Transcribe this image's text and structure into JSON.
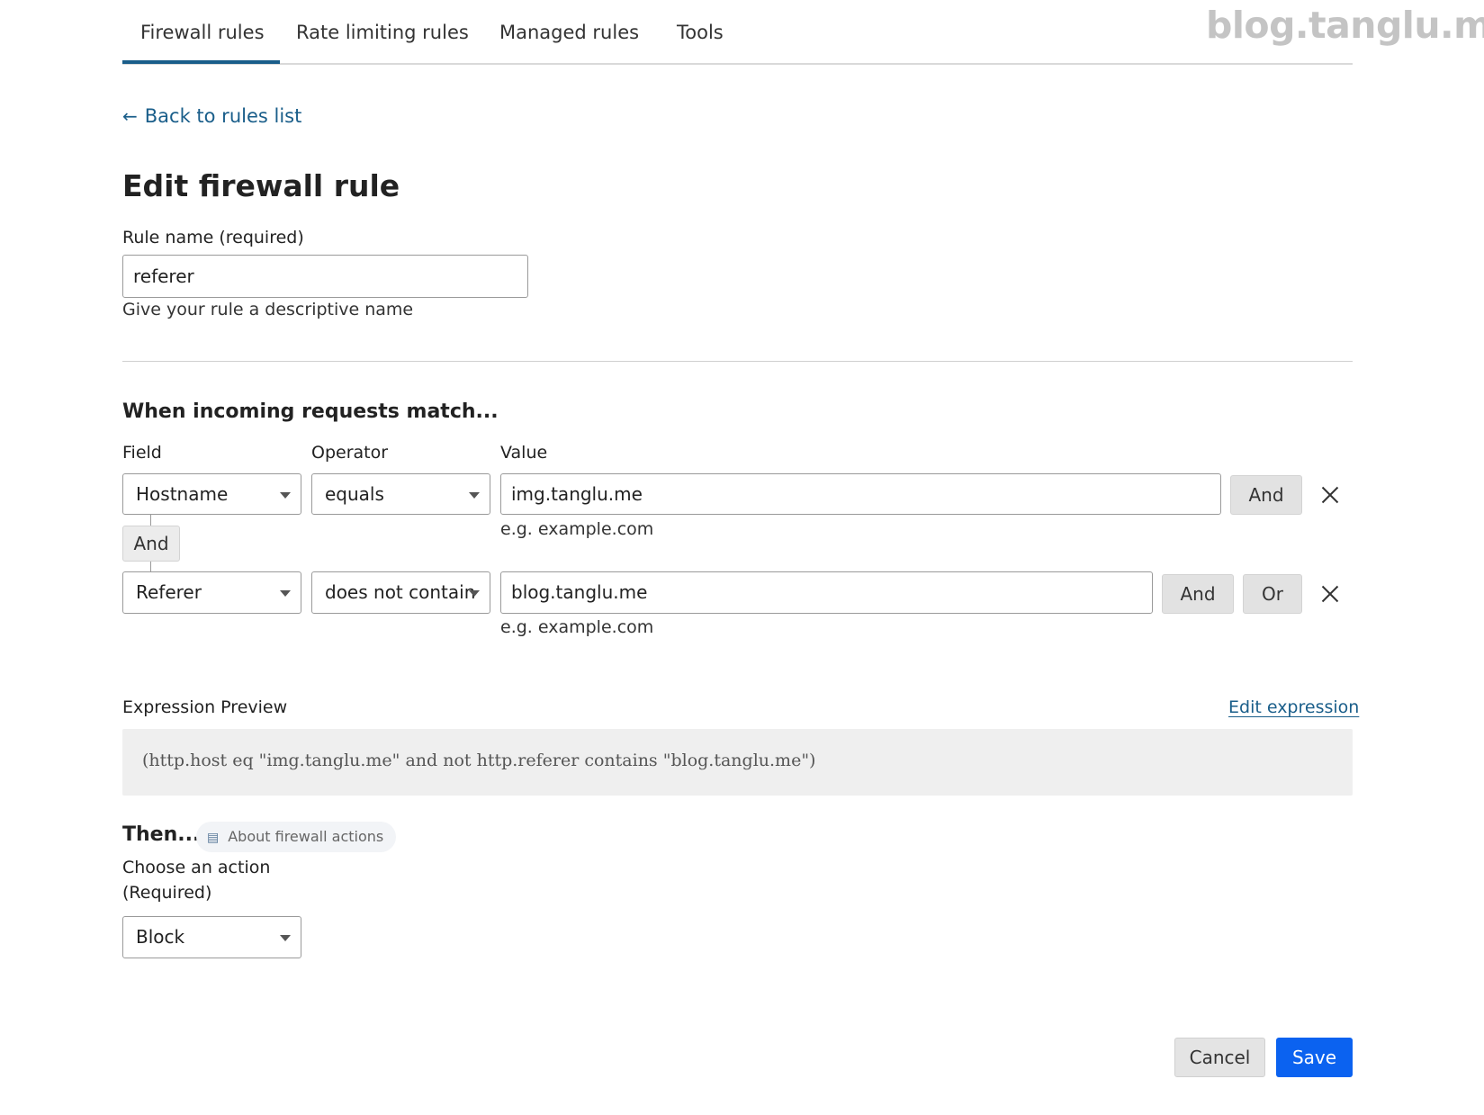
{
  "watermark": "blog.tanglu.me",
  "tabs": [
    {
      "label": "Firewall rules",
      "active": true
    },
    {
      "label": "Rate limiting rules",
      "active": false
    },
    {
      "label": "Managed rules",
      "active": false
    },
    {
      "label": "Tools",
      "active": false
    }
  ],
  "back_link": "Back to rules list",
  "page_title": "Edit firewall rule",
  "rule_name": {
    "label": "Rule name (required)",
    "value": "referer",
    "hint": "Give your rule a descriptive name"
  },
  "match_section": {
    "title": "When incoming requests match...",
    "headers": {
      "field": "Field",
      "operator": "Operator",
      "value": "Value"
    },
    "conditions": [
      {
        "field": "Hostname",
        "operator": "equals",
        "value": "img.tanglu.me",
        "hint": "e.g. example.com",
        "buttons": [
          "And"
        ]
      },
      {
        "field": "Referer",
        "operator": "does not contain",
        "value": "blog.tanglu.me",
        "hint": "e.g. example.com",
        "buttons": [
          "And",
          "Or"
        ]
      }
    ],
    "connector_label": "And"
  },
  "expression": {
    "label": "Expression Preview",
    "edit_link": "Edit expression",
    "text": "(http.host eq \"img.tanglu.me\" and not http.referer contains \"blog.tanglu.me\")"
  },
  "action_section": {
    "title": "Then...",
    "about_link": "About firewall actions",
    "choose_label_line1": "Choose an action",
    "choose_label_line2": "(Required)",
    "selected_action": "Block"
  },
  "footer": {
    "cancel": "Cancel",
    "save": "Save"
  },
  "colors": {
    "accent": "#1a5e8a",
    "primary_button": "#0b62f0",
    "secondary_button": "#e2e2e2",
    "expression_bg": "#efefef"
  }
}
